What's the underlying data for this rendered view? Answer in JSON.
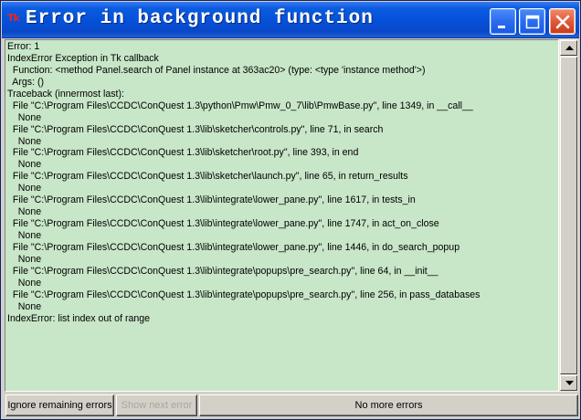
{
  "window": {
    "title": "Error in background function",
    "app_icon": "Tk",
    "controls": {
      "minimize": "minimize-icon",
      "maximize": "maximize-icon",
      "close": "close-icon"
    }
  },
  "error_text": {
    "lines": [
      "Error: 1",
      "IndexError Exception in Tk callback",
      "  Function: <method Panel.search of Panel instance at 363ac20> (type: <type 'instance method'>)",
      "  Args: ()",
      "Traceback (innermost last):",
      "  File \"C:\\Program Files\\CCDC\\ConQuest 1.3\\python\\Pmw\\Pmw_0_7\\lib\\PmwBase.py\", line 1349, in __call__",
      "    None",
      "  File \"C:\\Program Files\\CCDC\\ConQuest 1.3\\lib\\sketcher\\controls.py\", line 71, in search",
      "    None",
      "  File \"C:\\Program Files\\CCDC\\ConQuest 1.3\\lib\\sketcher\\root.py\", line 393, in end",
      "    None",
      "  File \"C:\\Program Files\\CCDC\\ConQuest 1.3\\lib\\sketcher\\launch.py\", line 65, in return_results",
      "    None",
      "  File \"C:\\Program Files\\CCDC\\ConQuest 1.3\\lib\\integrate\\lower_pane.py\", line 1617, in tests_in",
      "    None",
      "  File \"C:\\Program Files\\CCDC\\ConQuest 1.3\\lib\\integrate\\lower_pane.py\", line 1747, in act_on_close",
      "    None",
      "  File \"C:\\Program Files\\CCDC\\ConQuest 1.3\\lib\\integrate\\lower_pane.py\", line 1446, in do_search_popup",
      "    None",
      "  File \"C:\\Program Files\\CCDC\\ConQuest 1.3\\lib\\integrate\\popups\\pre_search.py\", line 64, in __init__",
      "    None",
      "  File \"C:\\Program Files\\CCDC\\ConQuest 1.3\\lib\\integrate\\popups\\pre_search.py\", line 256, in pass_databases",
      "    None",
      "IndexError: list index out of range"
    ]
  },
  "buttons": {
    "ignore": "Ignore remaining errors",
    "show_next": "Show next error",
    "no_more": "No more errors"
  },
  "colors": {
    "text_background": "#c8e6c8",
    "titlebar": "#0450d8",
    "close_button": "#e05a3a",
    "disabled_text": "#a8a6a0"
  }
}
